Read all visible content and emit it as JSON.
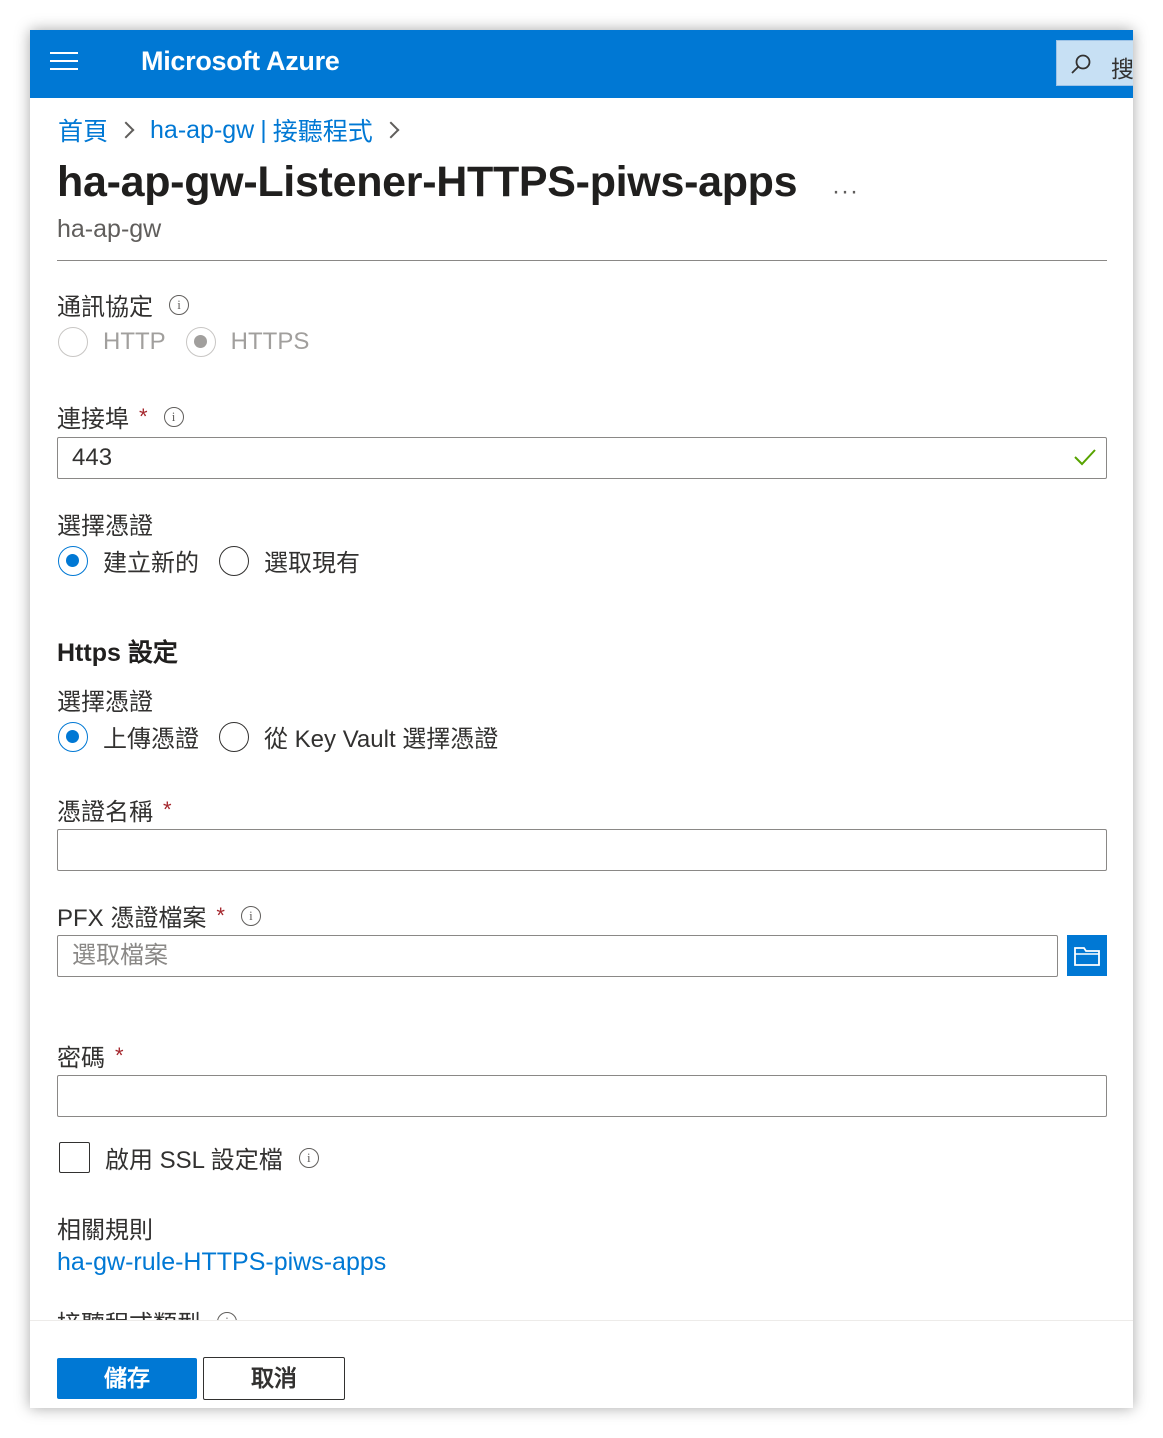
{
  "header": {
    "brand": "Microsoft Azure",
    "search_text": "搜"
  },
  "breadcrumb": {
    "home": "首頁",
    "gateway": "ha-ap-gw",
    "separator": "|",
    "listeners": "接聽程式"
  },
  "page": {
    "title": "ha-ap-gw-Listener-HTTPS-piws-apps",
    "more": "···",
    "subtitle": "ha-ap-gw"
  },
  "protocol": {
    "label": "通訊協定",
    "options": [
      "HTTP",
      "HTTPS"
    ],
    "selected": "HTTPS"
  },
  "port": {
    "label": "連接埠",
    "required": "*",
    "value": "443"
  },
  "certificate_choice": {
    "label": "選擇憑證",
    "options": [
      "建立新的",
      "選取現有"
    ],
    "selected": "建立新的"
  },
  "https_settings": {
    "title": "Https 設定",
    "cert_label": "選擇憑證",
    "options": [
      "上傳憑證",
      "從 Key Vault 選擇憑證"
    ],
    "selected": "上傳憑證"
  },
  "cert_name": {
    "label": "憑證名稱",
    "required": "*",
    "value": ""
  },
  "pfx_file": {
    "label": "PFX 憑證檔案",
    "required": "*",
    "placeholder": "選取檔案"
  },
  "password": {
    "label": "密碼",
    "required": "*",
    "value": ""
  },
  "ssl_profile": {
    "label": "啟用 SSL 設定檔",
    "checked": false
  },
  "related_rules": {
    "label": "相關規則",
    "link": "ha-gw-rule-HTTPS-piws-apps"
  },
  "listener_type": {
    "label": "接聽程式類型"
  },
  "footer": {
    "save": "儲存",
    "cancel": "取消"
  },
  "colors": {
    "accent": "#0078d4",
    "required": "#a4262c",
    "valid": "#57a300"
  }
}
